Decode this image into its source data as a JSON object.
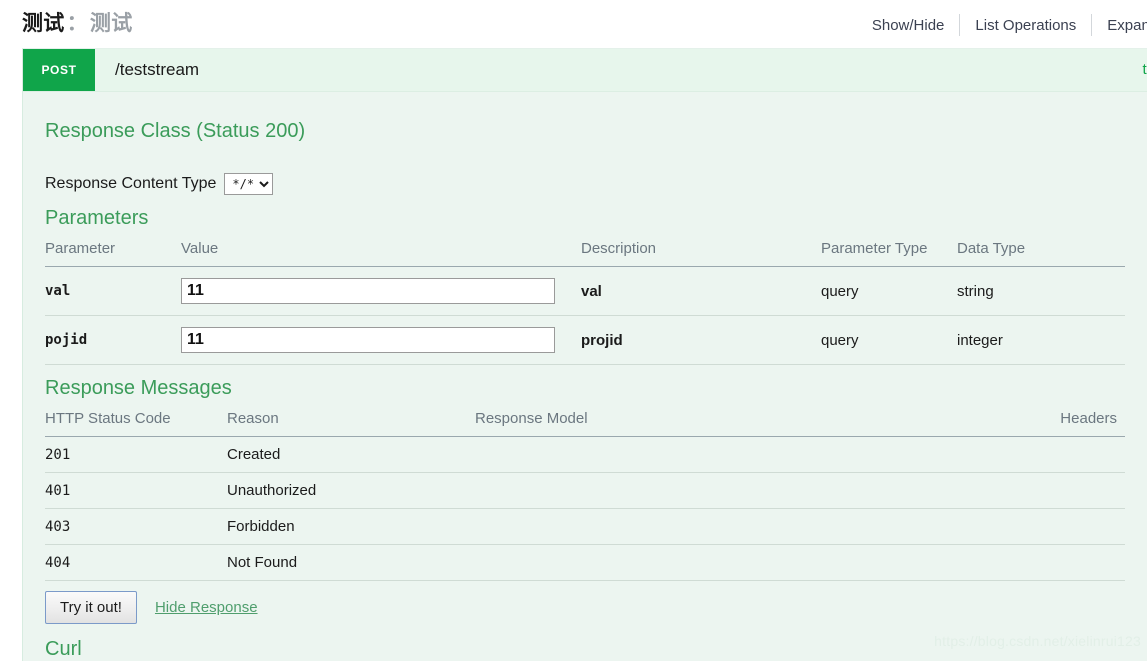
{
  "resource": {
    "title_main": "测试",
    "title_separator": "：",
    "title_sub": "测试",
    "options": [
      {
        "label": "Show/Hide"
      },
      {
        "label": "List Operations"
      },
      {
        "label": "Expand O"
      }
    ]
  },
  "operation": {
    "method": "POST",
    "path": "/teststream",
    "summary": "te"
  },
  "response_class": {
    "heading": "Response Class (Status 200)",
    "content_type_label": "Response Content Type",
    "content_type_value": "*/*",
    "content_type_options": [
      "*/*"
    ]
  },
  "parameters": {
    "heading": "Parameters",
    "columns": [
      "Parameter",
      "Value",
      "Description",
      "Parameter Type",
      "Data Type"
    ],
    "rows": [
      {
        "name": "val",
        "value": "11",
        "description": "val",
        "param_type": "query",
        "data_type": "string"
      },
      {
        "name": "pojid",
        "value": "11",
        "description": "projid",
        "param_type": "query",
        "data_type": "integer"
      }
    ]
  },
  "response_messages": {
    "heading": "Response Messages",
    "columns": [
      "HTTP Status Code",
      "Reason",
      "Response Model",
      "Headers"
    ],
    "rows": [
      {
        "code": "201",
        "reason": "Created",
        "model": "",
        "headers": ""
      },
      {
        "code": "401",
        "reason": "Unauthorized",
        "model": "",
        "headers": ""
      },
      {
        "code": "403",
        "reason": "Forbidden",
        "model": "",
        "headers": ""
      },
      {
        "code": "404",
        "reason": "Not Found",
        "model": "",
        "headers": ""
      }
    ]
  },
  "actions": {
    "try_it_out": "Try it out!",
    "hide_response": "Hide Response"
  },
  "curl": {
    "heading": "Curl"
  },
  "watermark": {
    "text": "https://blog.csdn.net/xielinrui123"
  },
  "colors": {
    "method_post": "#10a54a",
    "section_heading": "#3b9c5a",
    "panel_background": "#ecf5f0",
    "operation_header": "#e7f6ec"
  }
}
